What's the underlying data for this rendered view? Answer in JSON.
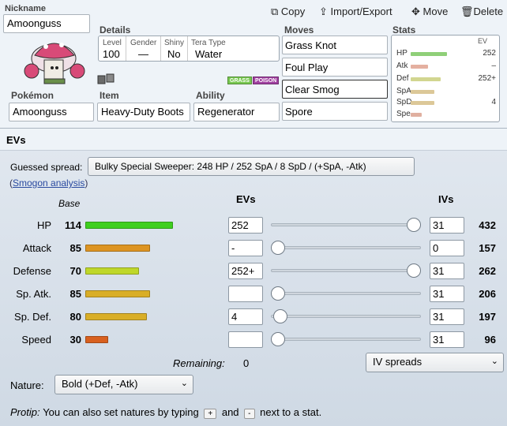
{
  "header": {
    "nickname_label": "Nickname",
    "nickname": "Amoonguss",
    "buttons": {
      "copy": "Copy",
      "import_export": "Import/Export",
      "move": "Move",
      "delete": "Delete"
    }
  },
  "details": {
    "section_label": "Details",
    "level_label": "Level",
    "level": "100",
    "gender_label": "Gender",
    "gender": "—",
    "shiny_label": "Shiny",
    "shiny": "No",
    "tera_label": "Tera Type",
    "tera": "Water",
    "types": [
      "GRASS",
      "POISON"
    ],
    "type_colors": {
      "grass": "#78c850",
      "poison": "#a040a0"
    }
  },
  "pokemon": {
    "label": "Pokémon",
    "value": "Amoonguss"
  },
  "item": {
    "label": "Item",
    "value": "Heavy-Duty Boots"
  },
  "ability": {
    "label": "Ability",
    "value": "Regenerator"
  },
  "moves": {
    "label": "Moves",
    "list": [
      "Grass Knot",
      "Foul Play",
      "Clear Smog",
      "Spore"
    ]
  },
  "stats_panel": {
    "label": "Stats",
    "ev_header": "EV",
    "rows": [
      {
        "label": "HP",
        "value": "252"
      },
      {
        "label": "Atk",
        "value": "–"
      },
      {
        "label": "Def",
        "value": "252+"
      },
      {
        "label": "SpA",
        "value": ""
      },
      {
        "label": "SpD",
        "value": "4"
      },
      {
        "label": "Spe",
        "value": ""
      }
    ]
  },
  "evs_section": {
    "title": "EVs",
    "guessed_label": "Guessed spread:",
    "guessed_button": "Bulky Special Sweeper: 248 HP / 252 SpA / 8 SpD / (+SpA, -Atk)",
    "analysis_prefix": "(",
    "analysis_link": "Smogon analysis",
    "analysis_suffix": ")",
    "col_base": "Base",
    "col_evs": "EVs",
    "col_ivs": "IVs",
    "stats": [
      {
        "name": "HP",
        "base": "114",
        "ev": "252",
        "iv": "31",
        "total": "432",
        "color": "#3fcf1f",
        "ev_fraction": 1.0
      },
      {
        "name": "Attack",
        "base": "85",
        "ev": "-",
        "iv": "0",
        "total": "157",
        "color": "#dd9422",
        "ev_fraction": 0.0
      },
      {
        "name": "Defense",
        "base": "70",
        "ev": "252+",
        "iv": "31",
        "total": "262",
        "color": "#bfd72a",
        "ev_fraction": 1.0
      },
      {
        "name": "Sp. Atk.",
        "base": "85",
        "ev": "",
        "iv": "31",
        "total": "206",
        "color": "#d9ae27",
        "ev_fraction": 0.0
      },
      {
        "name": "Sp. Def.",
        "base": "80",
        "ev": "4",
        "iv": "31",
        "total": "197",
        "color": "#d9ae27",
        "ev_fraction": 0.016
      },
      {
        "name": "Speed",
        "base": "30",
        "ev": "",
        "iv": "31",
        "total": "96",
        "color": "#d8601f",
        "ev_fraction": 0.0
      }
    ],
    "remaining_label": "Remaining:",
    "remaining": "0",
    "iv_spreads": "IV spreads",
    "nature_label": "Nature:",
    "nature": "Bold (+Def, -Atk)",
    "protip_label": "Protip:",
    "protip_text_1": "You can also set natures by typing",
    "protip_key_plus": "+",
    "protip_and": "and",
    "protip_key_minus": "-",
    "protip_text_2": "next to a stat."
  }
}
